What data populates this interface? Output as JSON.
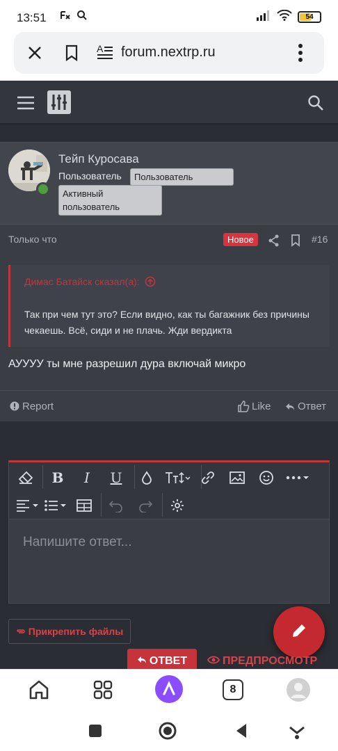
{
  "status_bar": {
    "time": "13:51",
    "battery": "54",
    "icons": [
      "notification-icon",
      "search-icon",
      "signal-icon",
      "wifi-icon",
      "battery-icon"
    ]
  },
  "browser": {
    "url": "forum.nextrp.ru",
    "icons": [
      "close-icon",
      "bookmark-icon",
      "reader-mode-icon",
      "more-vert-icon"
    ]
  },
  "forum_header": {
    "icons": [
      "menu-icon",
      "forum-logo-icon",
      "search-icon"
    ]
  },
  "post": {
    "author": "Тейп Куросава",
    "user_title": "Пользователь",
    "badges": [
      "Пользователь",
      "Активный пользователь"
    ],
    "time": "Только что",
    "new_label": "Новое",
    "post_number": "#16",
    "quote": {
      "author_line": "Димас Батайск сказал(а):",
      "text": "Так при чем тут это? Если видно, как ты багажник без причины чекаешь. Всё, сиди и не плачь. Жди вердикта"
    },
    "message": "АУУУУ ты мне разрешил дура включай микро",
    "actions": {
      "report": "Report",
      "like": "Like",
      "reply": "Ответ"
    }
  },
  "editor": {
    "placeholder": "Напишите ответ...",
    "toolbar_icons": [
      "eraser-icon",
      "bold-icon",
      "italic-icon",
      "underline-icon",
      "color-drop-icon",
      "font-size-icon",
      "link-icon",
      "image-icon",
      "emoji-icon",
      "more-horiz-icon",
      "align-icon",
      "list-icon",
      "table-icon",
      "undo-icon",
      "redo-icon",
      "settings-icon"
    ],
    "bold": "B",
    "italic": "I",
    "underline": "U"
  },
  "buttons": {
    "attach_files": "Прикрепить файлы",
    "reply": "ОТВЕТ",
    "preview": "ПРЕДПРОСМОТР"
  },
  "bottom_nav": {
    "tab_count": "8",
    "icons": [
      "home-icon",
      "apps-grid-icon",
      "alice-assistant-icon",
      "tabs-icon",
      "profile-avatar-icon"
    ]
  },
  "colors": {
    "accent": "#c7333a",
    "page_bg": "#2a2d33",
    "card_bg": "#3a3d44",
    "online": "#4f9e3f"
  }
}
